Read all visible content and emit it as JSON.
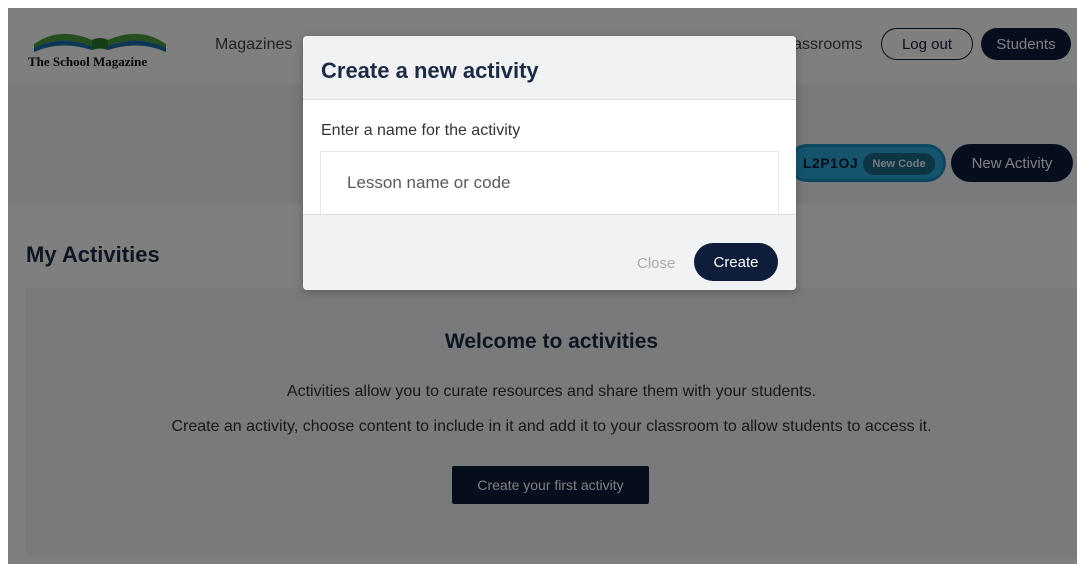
{
  "header": {
    "logo_text": "The School Magazine",
    "nav": {
      "magazines": "Magazines",
      "classrooms": "Classrooms"
    },
    "logout_label": "Log out",
    "students_label": "Students"
  },
  "toolbar": {
    "class_code": "L2P1OJ",
    "new_code_label": "New Code",
    "new_activity_label": "New Activity"
  },
  "main": {
    "section_title": "My Activities",
    "welcome": {
      "title": "Welcome to activities",
      "line1": "Activities allow you to curate resources and share them with your students.",
      "line2": "Create an activity, choose content to include in it and add it to your classroom to allow students to access it.",
      "cta_label": "Create your first activity"
    }
  },
  "modal": {
    "title": "Create a new activity",
    "label": "Enter a name for the activity",
    "input_placeholder": "Lesson name or code",
    "input_value": "",
    "close_label": "Close",
    "create_label": "Create"
  },
  "colors": {
    "navy": "#0d1d3a",
    "accent_blue": "#2aa8d8",
    "logo_green": "#4a9a3c",
    "logo_blue": "#1a6ea8"
  }
}
